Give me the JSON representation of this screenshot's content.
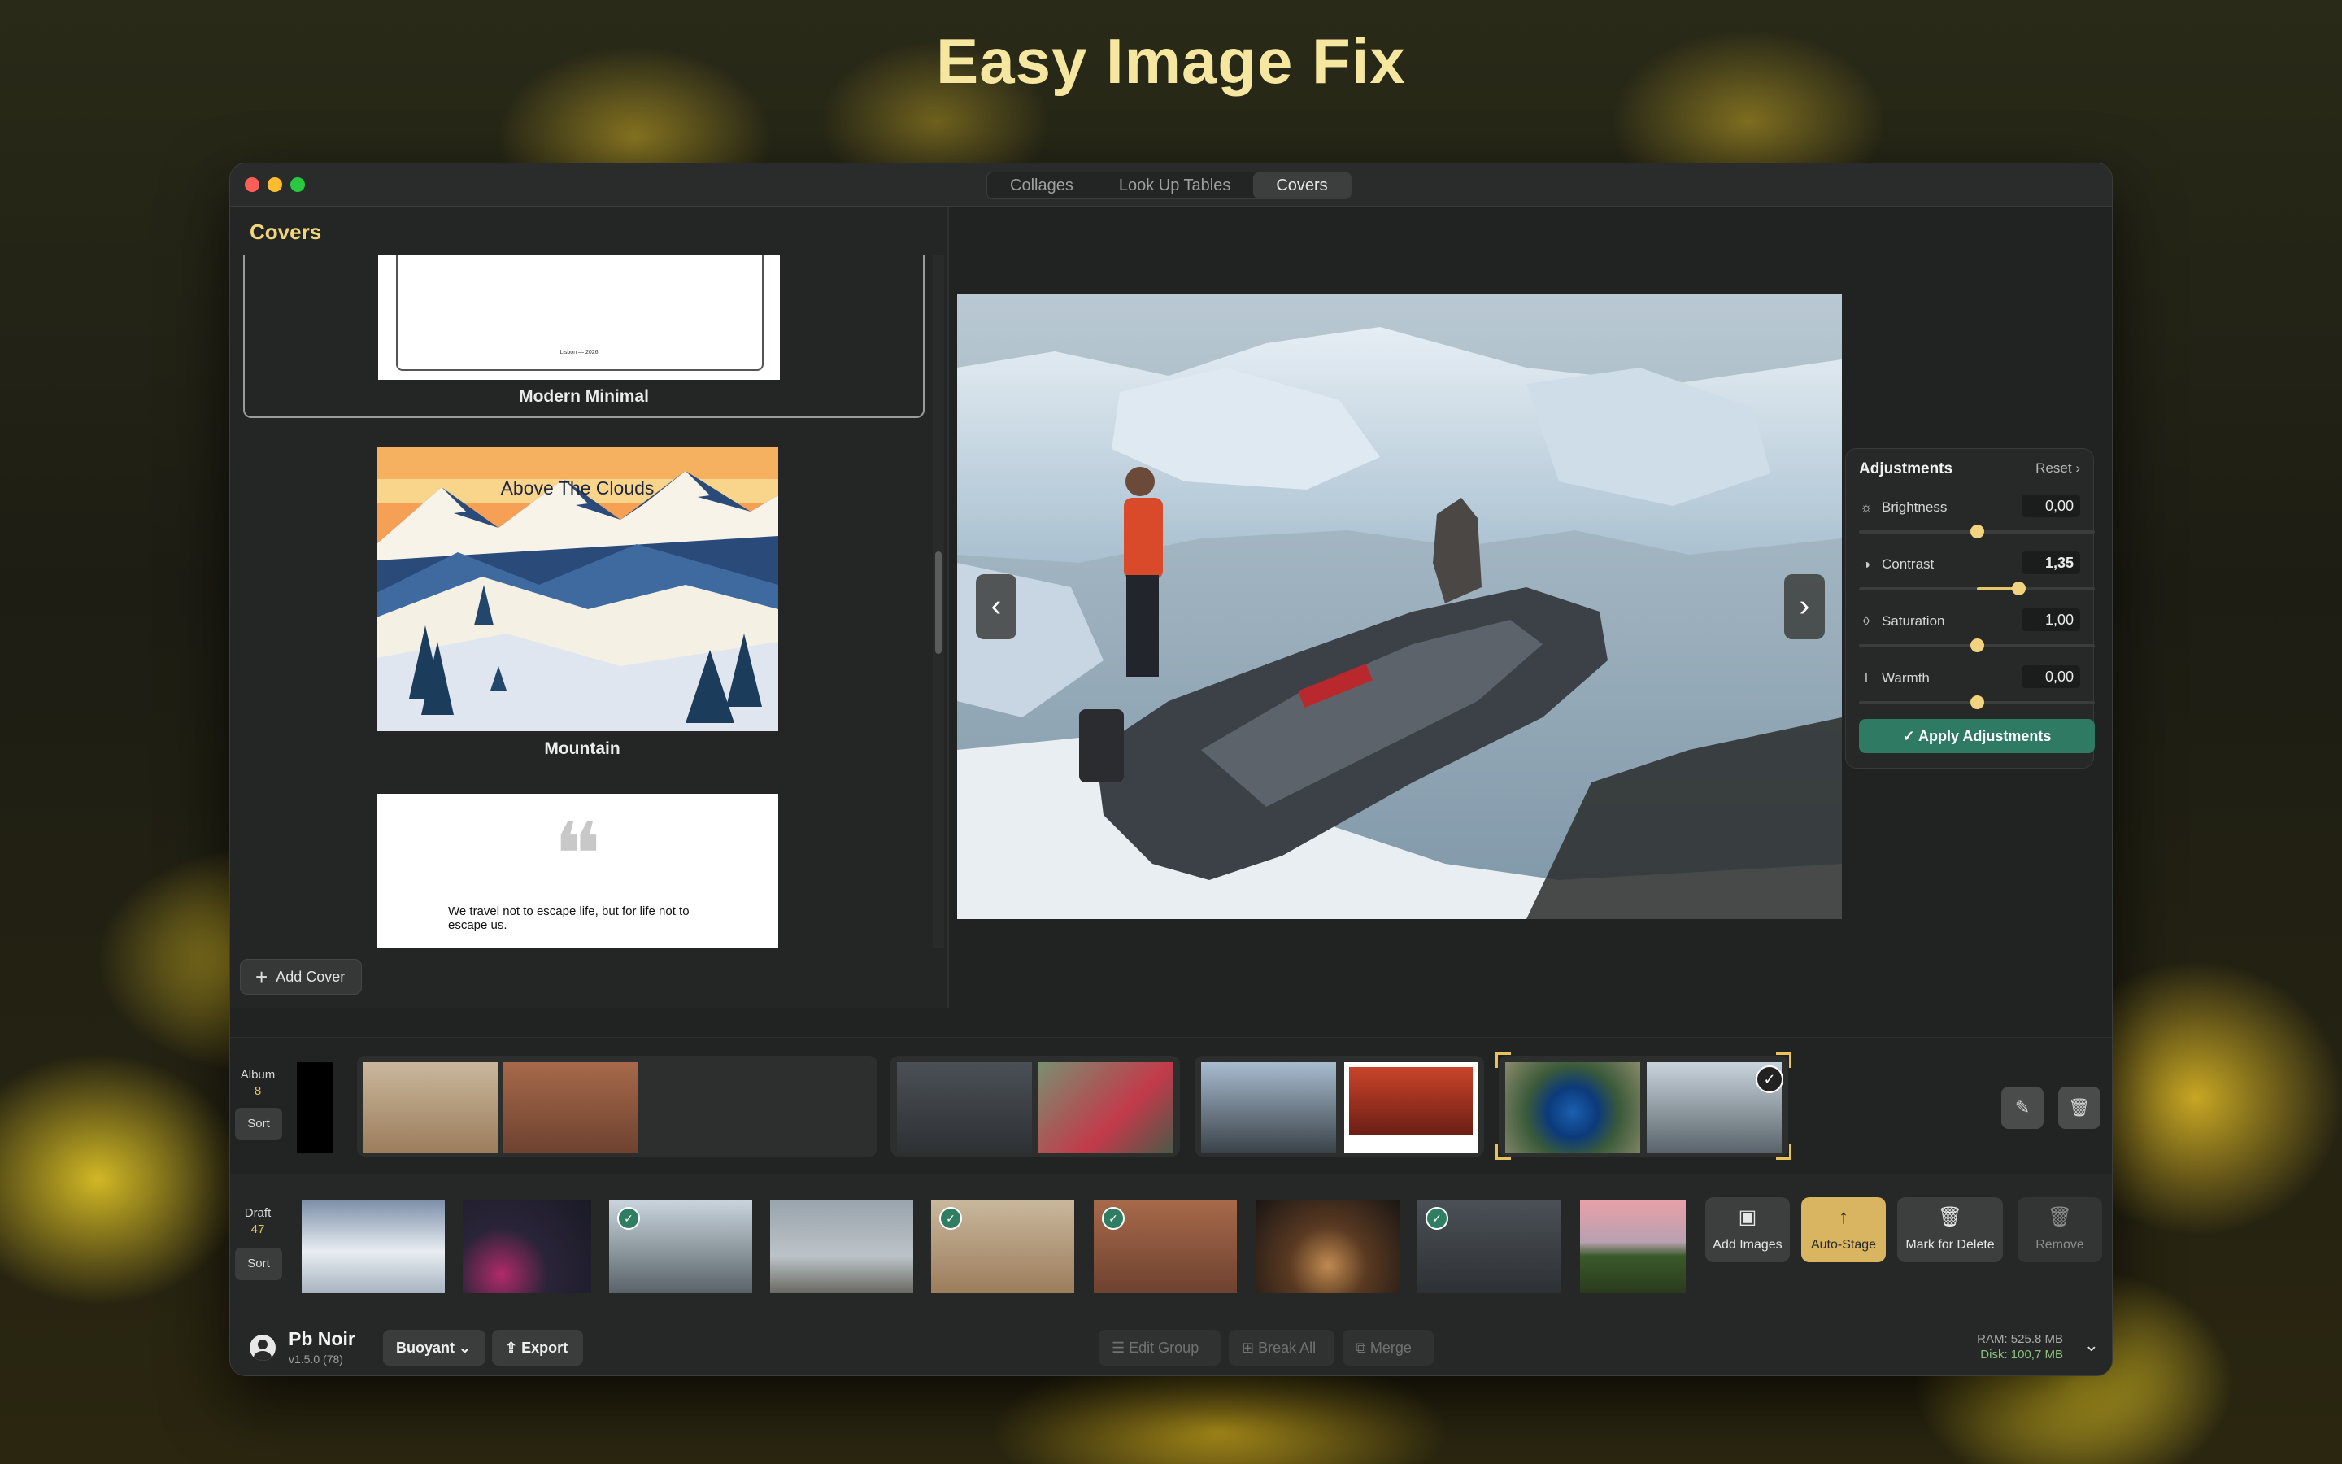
{
  "headline": "Easy Image Fix",
  "window": {
    "tabs": [
      {
        "label": "Collages",
        "active": false
      },
      {
        "label": "Look Up Tables",
        "active": false
      },
      {
        "label": "Covers",
        "active": true
      }
    ]
  },
  "covers_panel": {
    "title": "Covers",
    "items": [
      {
        "name": "Modern Minimal",
        "subtitle": "Lisbon — 2026",
        "selected": true
      },
      {
        "name": "Mountain",
        "thumbnail_title": "Above The Clouds"
      },
      {
        "name": "",
        "quote_mark": "❝",
        "quote": "We travel not to escape life, but for life not to escape us."
      }
    ],
    "add_cover_label": "Add Cover"
  },
  "adjustments": {
    "title": "Adjustments",
    "reset_label": "Reset",
    "rows": [
      {
        "label": "Brightness",
        "value_text": "0,00",
        "value": 0.0,
        "min": -1,
        "max": 1,
        "icon": "sun-icon"
      },
      {
        "label": "Contrast",
        "value_text": "1,35",
        "value": 1.35,
        "min": 0,
        "max": 2,
        "icon": "contrast-icon"
      },
      {
        "label": "Saturation",
        "value_text": "1,00",
        "value": 1.0,
        "min": 0,
        "max": 2,
        "icon": "drop-icon"
      },
      {
        "label": "Warmth",
        "value_text": "0,00",
        "value": 0.0,
        "min": -1,
        "max": 1,
        "icon": "thermometer-icon"
      }
    ],
    "apply_label": "Apply Adjustments"
  },
  "album": {
    "label": "Album",
    "count": "8",
    "sort_label": "Sort"
  },
  "draft": {
    "label": "Draft",
    "count": "47",
    "sort_label": "Sort"
  },
  "actions": {
    "add_images": "Add Images",
    "auto_stage": "Auto-Stage",
    "mark_for_delete": "Mark for Delete",
    "remove": "Remove"
  },
  "footer": {
    "app_name": "Pb Noir",
    "version": "v1.5.0 (78)",
    "theme_label": "Buoyant",
    "export_label": "Export",
    "edit_group_label": "Edit Group",
    "break_all_label": "Break All",
    "merge_label": "Merge",
    "ram": "RAM: 525.8 MB",
    "disk": "Disk: 100,7 MB"
  },
  "colors": {
    "accent_gold": "#e8c35a",
    "apply_green": "#2e7a62",
    "title_yellow": "#f1d77a"
  }
}
